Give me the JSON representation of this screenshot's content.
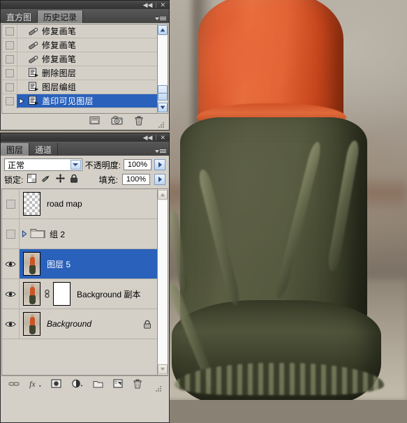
{
  "app": "Adobe Photoshop",
  "history_panel": {
    "titlebar": {
      "collapse": "◀◀",
      "close": "✕"
    },
    "tabs": [
      {
        "label": "直方图",
        "active": false
      },
      {
        "label": "历史记录",
        "active": true
      }
    ],
    "menu_icon": "panel-menu-icon",
    "items": [
      {
        "label": "修复画笔",
        "icon": "healing-brush-icon",
        "selected": false,
        "snapshot_marker": false
      },
      {
        "label": "修复画笔",
        "icon": "healing-brush-icon",
        "selected": false,
        "snapshot_marker": false
      },
      {
        "label": "修复画笔",
        "icon": "healing-brush-icon",
        "selected": false,
        "snapshot_marker": false
      },
      {
        "label": "删除图层",
        "icon": "layer-doc-icon",
        "selected": false,
        "snapshot_marker": false
      },
      {
        "label": "图层编组",
        "icon": "layer-doc-icon",
        "selected": false,
        "snapshot_marker": false
      },
      {
        "label": "盖印可见图层",
        "icon": "layer-doc-icon",
        "selected": true,
        "snapshot_marker": true
      }
    ],
    "footer_buttons": [
      {
        "name": "new-document-from-state-button",
        "icon": "new-document-icon"
      },
      {
        "name": "new-snapshot-button",
        "icon": "camera-icon"
      },
      {
        "name": "delete-state-button",
        "icon": "trash-icon"
      }
    ],
    "scrollbar": {
      "up": "▲",
      "down": "▼"
    }
  },
  "layers_panel": {
    "titlebar": {
      "collapse": "◀◀",
      "close": "✕"
    },
    "tabs": [
      {
        "label": "图层",
        "active": true
      },
      {
        "label": "通道",
        "active": false
      }
    ],
    "blend_mode": {
      "value": "正常"
    },
    "opacity": {
      "label": "不透明度:",
      "value": "100%"
    },
    "lock": {
      "label": "锁定:",
      "icons": [
        "lock-transparent-pixels-icon",
        "lock-image-pixels-icon",
        "lock-position-icon",
        "lock-all-icon"
      ]
    },
    "fill": {
      "label": "填充:",
      "value": "100%"
    },
    "layers": [
      {
        "name": "road map",
        "visible": false,
        "selected": false,
        "type": "normal",
        "thumb": "checker",
        "italic": false,
        "locked": false,
        "has_mask": false
      },
      {
        "name": "组 2",
        "visible": false,
        "selected": false,
        "type": "group",
        "thumb": "folder",
        "italic": false,
        "locked": false,
        "has_mask": false
      },
      {
        "name": "图层 5",
        "visible": true,
        "selected": true,
        "type": "normal",
        "thumb": "photo",
        "italic": false,
        "locked": false,
        "has_mask": false
      },
      {
        "name": "Background 副本",
        "visible": true,
        "selected": false,
        "type": "normal",
        "thumb": "photo",
        "italic": false,
        "locked": false,
        "has_mask": true
      },
      {
        "name": "Background",
        "visible": true,
        "selected": false,
        "type": "normal",
        "thumb": "photo",
        "italic": true,
        "locked": true,
        "has_mask": false
      }
    ],
    "footer_buttons": [
      {
        "name": "link-layers-button",
        "icon": "link-icon"
      },
      {
        "name": "layer-style-button",
        "icon": "fx-icon"
      },
      {
        "name": "add-layer-mask-button",
        "icon": "mask-icon"
      },
      {
        "name": "new-adjustment-layer-button",
        "icon": "adjustment-half-circle-icon"
      },
      {
        "name": "new-group-button",
        "icon": "folder-icon"
      },
      {
        "name": "new-layer-button",
        "icon": "new-layer-icon"
      },
      {
        "name": "delete-layer-button",
        "icon": "trash-icon"
      }
    ],
    "scrollbar": {
      "up": "▲",
      "down": "▼",
      "enabled": false
    }
  },
  "canvas": {
    "description": "photograph of a woman in an orange top and olive green ruffled skirt",
    "colors": {
      "top": "#d8542a",
      "skirt": "#4a4e35",
      "wall": "#a9a195"
    }
  },
  "colors": {
    "selection": "#2a61bb",
    "panel_bg": "#d4d0c8",
    "chrome_dark": "#3b3b3b"
  }
}
